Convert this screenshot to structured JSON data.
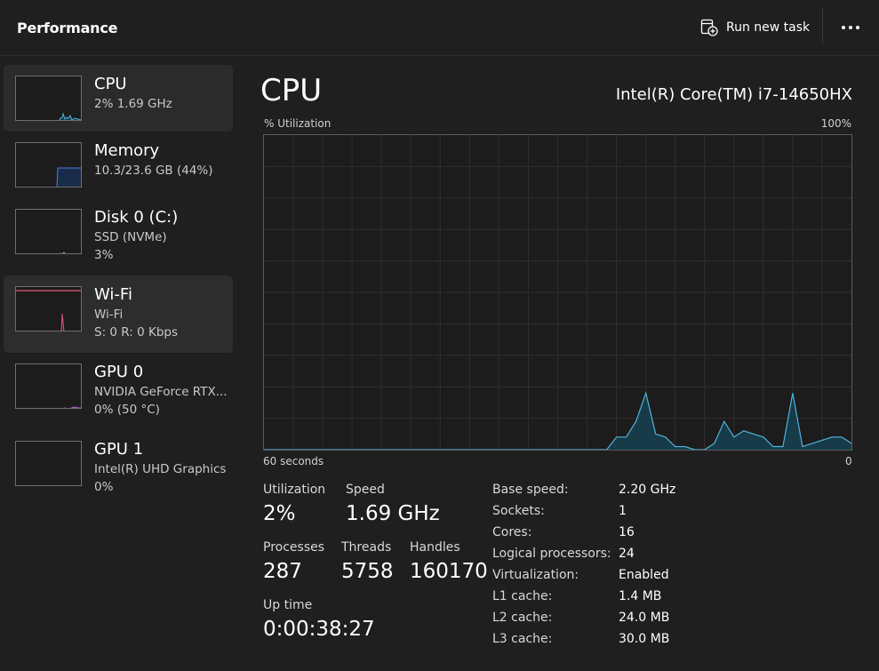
{
  "header": {
    "title": "Performance",
    "run_new_task": "Run new task",
    "icons": {
      "run": "run-task-icon",
      "more": "more-options-icon"
    }
  },
  "sidebar": {
    "items": [
      {
        "name": "CPU",
        "line1": "2%  1.69 GHz",
        "line2": "",
        "color": "#4fb3d9",
        "icon": "cpu-thumbnail"
      },
      {
        "name": "Memory",
        "line1": "10.3/23.6 GB (44%)",
        "line2": "",
        "color": "#4d7fd6",
        "icon": "memory-thumbnail"
      },
      {
        "name": "Disk 0 (C:)",
        "line1": "SSD (NVMe)",
        "line2": "3%",
        "color": "#7cc24b",
        "icon": "disk-thumbnail"
      },
      {
        "name": "Wi-Fi",
        "line1": "Wi-Fi",
        "line2": "S: 0  R: 0 Kbps",
        "color": "#e0557e",
        "icon": "wifi-thumbnail"
      },
      {
        "name": "GPU 0",
        "line1": "NVIDIA GeForce RTX...",
        "line2": "0%  (50 °C)",
        "color": "#b36fd1",
        "icon": "gpu0-thumbnail"
      },
      {
        "name": "GPU 1",
        "line1": "Intel(R) UHD Graphics",
        "line2": "0%",
        "color": "#b36fd1",
        "icon": "gpu1-thumbnail"
      }
    ]
  },
  "main": {
    "title": "CPU",
    "model": "Intel(R) Core(TM) i7-14650HX",
    "graph": {
      "y_label": "% Utilization",
      "y_max_label": "100%",
      "x_left_label": "60 seconds",
      "x_right_label": "0",
      "line_color": "#4fb3d9",
      "fill_color": "#173b48"
    },
    "stats": {
      "utilization_label": "Utilization",
      "utilization": "2%",
      "speed_label": "Speed",
      "speed": "1.69 GHz",
      "processes_label": "Processes",
      "processes": "287",
      "threads_label": "Threads",
      "threads": "5758",
      "handles_label": "Handles",
      "handles": "160170",
      "uptime_label": "Up time",
      "uptime": "0:00:38:27"
    },
    "info": [
      {
        "key": "Base speed:",
        "value": "2.20 GHz"
      },
      {
        "key": "Sockets:",
        "value": "1"
      },
      {
        "key": "Cores:",
        "value": "16"
      },
      {
        "key": "Logical processors:",
        "value": "24"
      },
      {
        "key": "Virtualization:",
        "value": "Enabled"
      },
      {
        "key": "L1 cache:",
        "value": "1.4 MB"
      },
      {
        "key": "L2 cache:",
        "value": "24.0 MB"
      },
      {
        "key": "L3 cache:",
        "value": "30.0 MB"
      }
    ]
  },
  "chart_data": {
    "type": "area",
    "title": "",
    "xlabel": "60 seconds",
    "ylabel": "% Utilization",
    "xlim": [
      -60,
      0
    ],
    "ylim": [
      0,
      100
    ],
    "grid": true,
    "series": [
      {
        "x": [
          -60,
          -54,
          -48,
          -42,
          -36,
          -30,
          -26,
          -25,
          -24,
          -23,
          -22,
          -21,
          -20,
          -19,
          -18,
          -17,
          -16,
          -15,
          -14,
          -13,
          -12,
          -11,
          -10,
          -9,
          -8,
          -7,
          -6,
          -5,
          -4,
          -3,
          -2,
          -1,
          0
        ],
        "values": [
          0,
          0,
          0,
          0,
          0,
          0,
          0,
          0,
          4,
          4,
          9,
          18,
          5,
          4,
          1,
          1,
          0,
          0,
          2,
          9,
          4,
          6,
          5,
          4,
          1,
          1,
          18,
          1,
          2,
          3,
          4,
          4,
          2
        ]
      }
    ]
  }
}
